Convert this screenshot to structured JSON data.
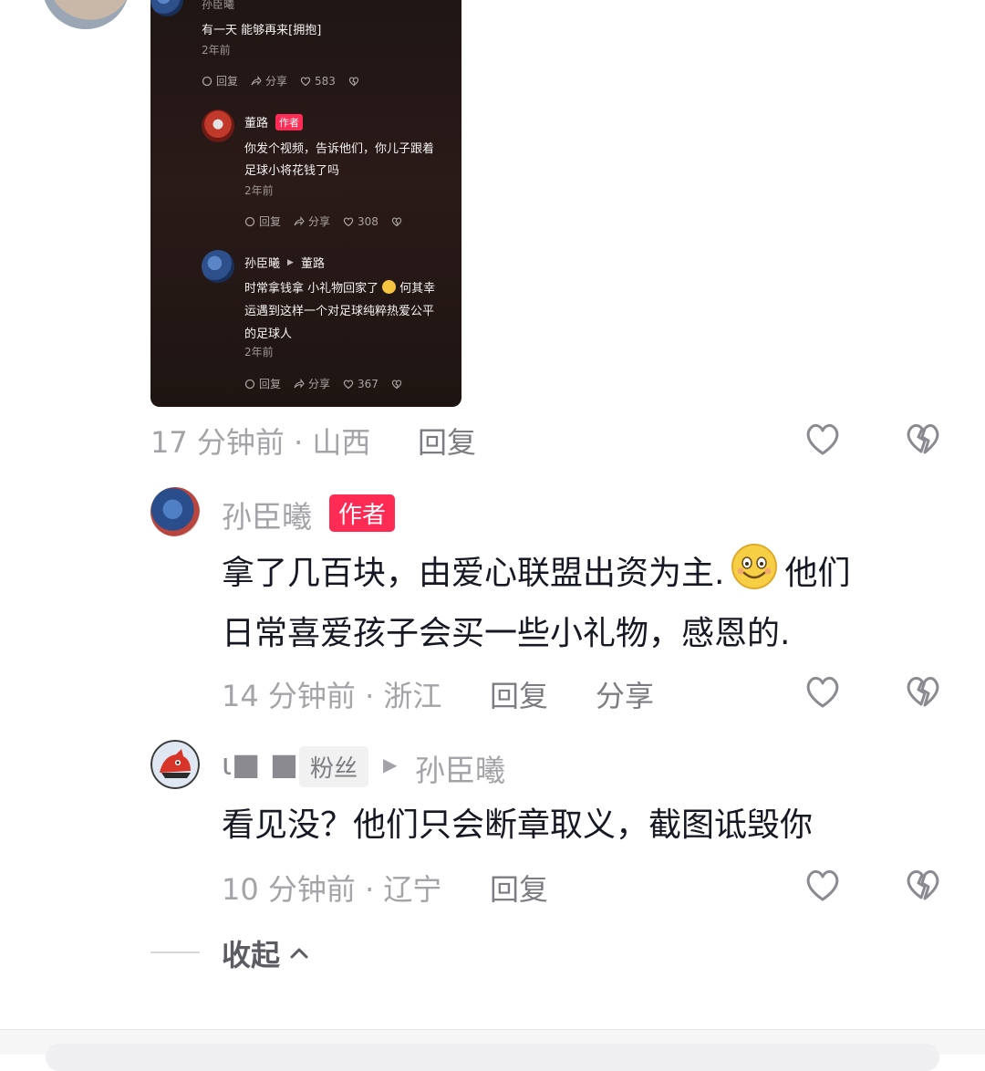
{
  "screenshot": {
    "top_author": "孙臣曦",
    "top_text": "有一天 能够再来[拥抱]",
    "top_time": "2年前",
    "top_actions": {
      "reply": "回复",
      "share": "分享",
      "likes": "583"
    },
    "reply1": {
      "author": "董路",
      "tag": "作者",
      "text_line1": "你发个视频，告诉他们，你儿子跟着",
      "text_line2": "足球小将花钱了吗",
      "time": "2年前",
      "actions": {
        "reply": "回复",
        "share": "分享",
        "likes": "308"
      }
    },
    "reply2": {
      "author": "孙臣曦",
      "reply_to": "董路",
      "text_line1a": "时常拿钱拿 小礼物回家了",
      "text_line1b": "何其幸",
      "text_line2": "运遇到这样一个对足球纯粹热爱公平",
      "text_line3": "的足球人",
      "time": "2年前",
      "actions": {
        "reply": "回复",
        "share": "分享",
        "likes": "367"
      }
    }
  },
  "comment1": {
    "meta": "17 分钟前 · 山西",
    "reply_label": "回复"
  },
  "comment2": {
    "author": "孙臣曦",
    "tag": "作者",
    "text_part1": "拿了几百块，由爱心联盟出资为主.",
    "text_part2": "他们",
    "text_line2": "日常喜爱孩子会买一些小礼物，感恩的.",
    "meta": "14 分钟前 · 浙江",
    "reply_label": "回复",
    "share_label": "分享"
  },
  "comment3": {
    "author_masked": "ι■ ■",
    "fan_tag": "粉丝",
    "reply_to": "孙臣曦",
    "text": "看见没？他们只会断章取义，截图诋毁你",
    "meta": "10 分钟前 · 辽宁",
    "reply_label": "回复"
  },
  "collapse_label": "收起",
  "colors": {
    "accent": "#fe2c55",
    "meta": "#a3a3a8",
    "text": "#161823"
  },
  "icons": [
    "heart-icon",
    "broken-heart-icon",
    "chevron-up-icon",
    "comment-icon",
    "share-icon",
    "play-triangle-icon"
  ]
}
